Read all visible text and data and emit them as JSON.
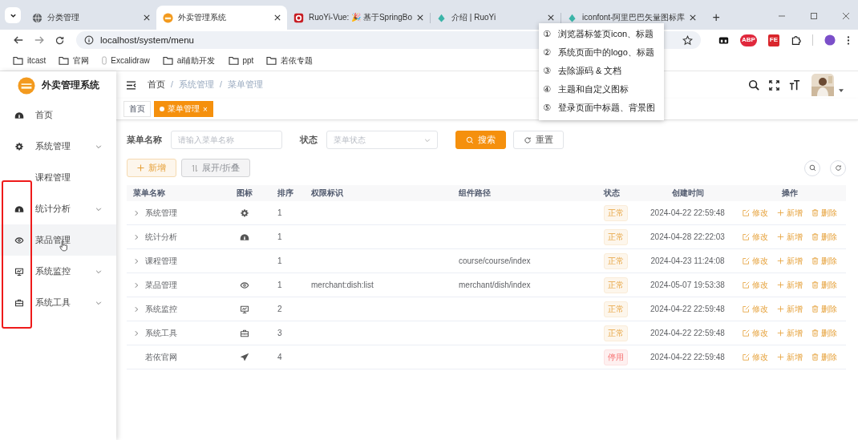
{
  "browser": {
    "tabs": [
      {
        "title": "分类管理",
        "selected": false
      },
      {
        "title": "外卖管理系统",
        "selected": true
      },
      {
        "title": "RuoYi-Vue: 🎉 基于SpringBo",
        "selected": false
      },
      {
        "title": "介绍 | RuoYi",
        "selected": false
      },
      {
        "title": "iconfont-阿里巴巴矢量图标库",
        "selected": false
      }
    ],
    "new_tab": "+",
    "url": "localhost/system/menu",
    "extensions": [
      "ABP",
      "FE"
    ],
    "bookmarks": [
      {
        "label": "itcast",
        "kind": "folder"
      },
      {
        "label": "官网",
        "kind": "folder"
      },
      {
        "label": "Excalidraw",
        "kind": "page"
      },
      {
        "label": "ai辅助开发",
        "kind": "folder"
      },
      {
        "label": "ppt",
        "kind": "folder"
      },
      {
        "label": "若依专题",
        "kind": "folder"
      }
    ]
  },
  "sidebar": {
    "title": "外卖管理系统",
    "items": [
      {
        "label": "首页",
        "kind": "item",
        "hovered": false
      },
      {
        "label": "系统管理",
        "kind": "submenu",
        "hovered": false
      },
      {
        "label": "课程管理",
        "kind": "item",
        "hovered": false
      },
      {
        "label": "统计分析",
        "kind": "submenu",
        "hovered": false
      },
      {
        "label": "菜品管理",
        "kind": "item",
        "hovered": true
      },
      {
        "label": "系统监控",
        "kind": "submenu",
        "hovered": false
      },
      {
        "label": "系统工具",
        "kind": "submenu",
        "hovered": false
      }
    ]
  },
  "breadcrumb": {
    "separator": "/",
    "items": [
      "首页",
      "系统管理",
      "菜单管理"
    ]
  },
  "tags": [
    {
      "label": "首页",
      "selected": false
    },
    {
      "label": "菜单管理",
      "selected": true,
      "close": "×"
    }
  ],
  "search_form": {
    "fields": [
      {
        "label": "菜单名称",
        "placeholder": "请输入菜单名称",
        "kind": "input"
      },
      {
        "label": "状态",
        "placeholder": "菜单状态",
        "kind": "select"
      }
    ],
    "search_button": "搜索",
    "reset_button": "重置"
  },
  "toolbar": {
    "add_button": "新增",
    "toggle_button": "展开/折叠"
  },
  "table": {
    "columns": [
      "菜单名称",
      "图标",
      "排序",
      "权限标识",
      "组件路径",
      "状态",
      "创建时间",
      "操作"
    ],
    "rows": [
      {
        "name": "系统管理",
        "expandable": true,
        "sort": "1",
        "perms": "",
        "component": "",
        "status": {
          "label": "正常",
          "kind": "normal"
        },
        "created": "2024-04-22 22:59:48",
        "actions": [
          "修改",
          "新增",
          "删除"
        ]
      },
      {
        "name": "统计分析",
        "expandable": true,
        "sort": "1",
        "perms": "",
        "component": "",
        "status": {
          "label": "正常",
          "kind": "normal"
        },
        "created": "2024-04-28 22:22:03",
        "actions": [
          "修改",
          "新增",
          "删除"
        ]
      },
      {
        "name": "课程管理",
        "expandable": true,
        "sort": "1",
        "perms": "",
        "component": "course/course/index",
        "status": {
          "label": "正常",
          "kind": "normal"
        },
        "created": "2024-04-23 11:24:08",
        "actions": [
          "修改",
          "新增",
          "删除"
        ]
      },
      {
        "name": "菜品管理",
        "expandable": true,
        "sort": "1",
        "perms": "merchant:dish:list",
        "component": "merchant/dish/index",
        "status": {
          "label": "正常",
          "kind": "normal"
        },
        "created": "2024-05-07 19:53:38",
        "actions": [
          "修改",
          "新增",
          "删除"
        ]
      },
      {
        "name": "系统监控",
        "expandable": true,
        "sort": "2",
        "perms": "",
        "component": "",
        "status": {
          "label": "正常",
          "kind": "normal"
        },
        "created": "2024-04-22 22:59:48",
        "actions": [
          "修改",
          "新增",
          "删除"
        ]
      },
      {
        "name": "系统工具",
        "expandable": true,
        "sort": "3",
        "perms": "",
        "component": "",
        "status": {
          "label": "正常",
          "kind": "normal"
        },
        "created": "2024-04-22 22:59:48",
        "actions": [
          "修改",
          "新增",
          "删除"
        ]
      },
      {
        "name": "若依官网",
        "expandable": false,
        "sort": "4",
        "perms": "",
        "component": "",
        "status": {
          "label": "停用",
          "kind": "disabled"
        },
        "created": "2024-04-22 22:59:48",
        "actions": [
          "修改",
          "新增",
          "删除"
        ]
      }
    ]
  },
  "popup_list": [
    {
      "marker": "①",
      "text": "浏览器标签页icon、标题"
    },
    {
      "marker": "②",
      "text": "系统页面中的logo、标题"
    },
    {
      "marker": "③",
      "text": "去除源码 & 文档"
    },
    {
      "marker": "④",
      "text": "主题和自定义图标"
    },
    {
      "marker": "⑤",
      "text": "登录页面中标题、背景图"
    }
  ]
}
